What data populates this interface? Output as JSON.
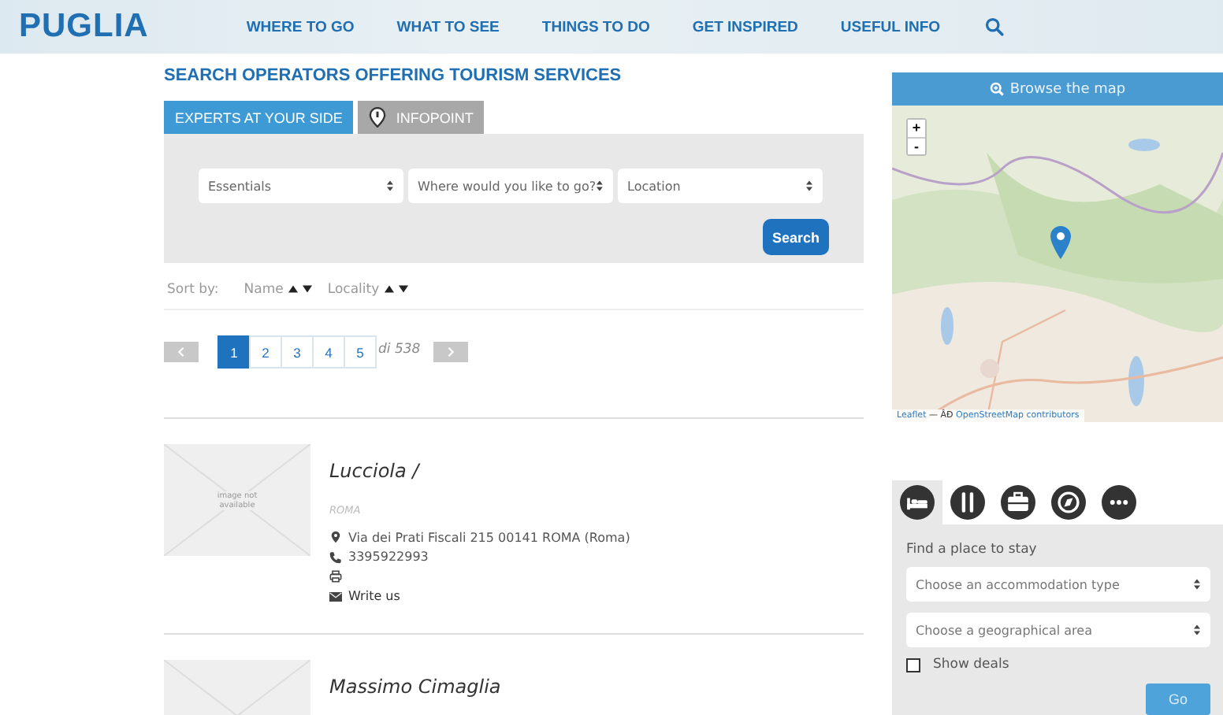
{
  "header": {
    "logo": "PUGLIA",
    "nav": [
      "WHERE TO GO",
      "WHAT TO SEE",
      "THINGS TO DO",
      "GET INSPIRED",
      "USEFUL INFO"
    ]
  },
  "page_title": "SEARCH OPERATORS OFFERING TOURISM SERVICES",
  "tabs": [
    {
      "label": "EXPERTS AT YOUR SIDE",
      "selected": true,
      "kind": "plain"
    },
    {
      "label": "INFOPOINT",
      "selected": false,
      "kind": "pin"
    }
  ],
  "filters": {
    "selects": [
      "Essentials",
      "Where would you like to go?",
      "Location"
    ],
    "button": "Search"
  },
  "sort": {
    "label": "Sort by:",
    "fields": [
      "Name",
      "Locality"
    ]
  },
  "pagination": {
    "pages": [
      {
        "label": "1",
        "selected": true
      },
      {
        "label": "2",
        "selected": false
      },
      {
        "label": "3",
        "selected": false
      },
      {
        "label": "4",
        "selected": false
      },
      {
        "label": "5",
        "selected": false
      }
    ],
    "total": "di 538"
  },
  "results": [
    {
      "image_text": "image not available",
      "name": "Lucciola /",
      "city": "ROMA",
      "address": "Via dei Prati Fiscali 215 00141 ROMA  (Roma)",
      "phone": "3395922993",
      "write": "Write us"
    },
    {
      "name": "Massimo Cimaglia"
    }
  ],
  "map": {
    "header": "Browse the map",
    "zoom": [
      "+",
      "-"
    ],
    "attribution_link": "Leaflet",
    "attribution_sep": "— ÂĐ",
    "attribution_credit": "OpenStreetMap contributors"
  },
  "finder": {
    "categories": [
      {
        "kind": "bed",
        "selected": true
      },
      {
        "kind": "fork",
        "selected": false
      },
      {
        "kind": "case",
        "selected": false
      },
      {
        "kind": "compass",
        "selected": false
      },
      {
        "kind": "more",
        "selected": false
      }
    ],
    "title": "Find a place to stay",
    "selects": [
      "Choose an accommodation type",
      "Choose a geographical area"
    ],
    "deals": {
      "label": "Show deals",
      "checked": false
    },
    "button": "Go"
  }
}
